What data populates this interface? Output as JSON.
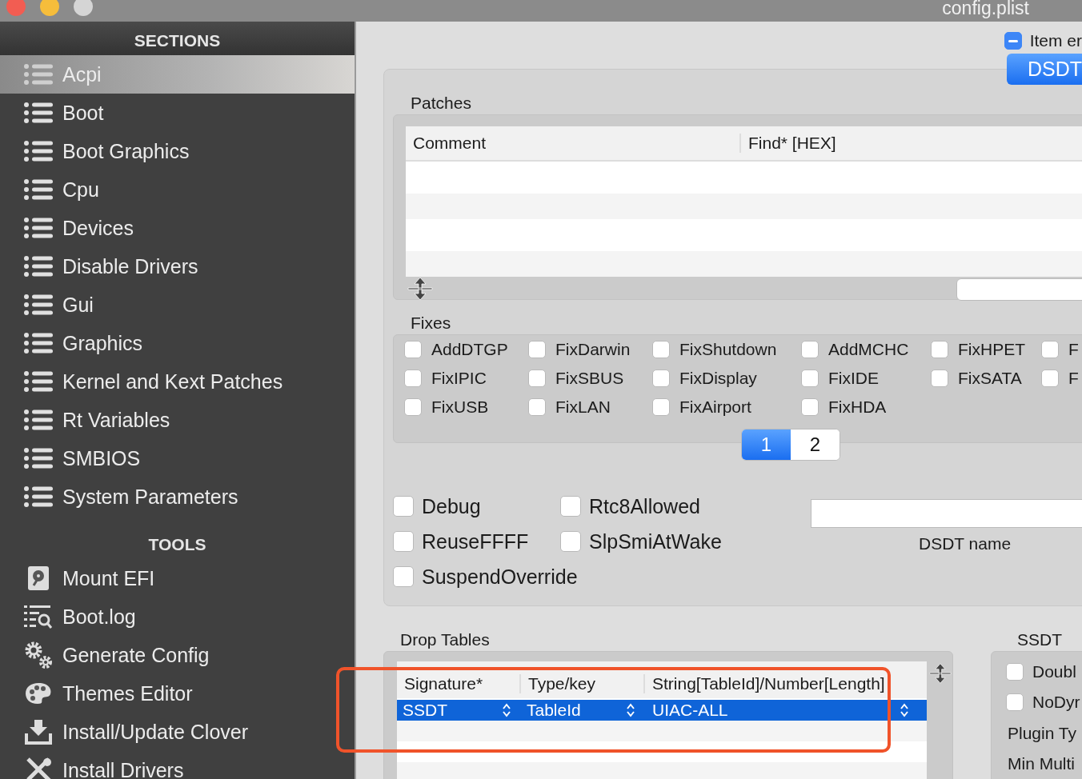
{
  "window": {
    "title": "config.plist"
  },
  "sidebar": {
    "sections_heading": "SECTIONS",
    "sections": [
      {
        "label": "Acpi",
        "selected": true
      },
      {
        "label": "Boot",
        "selected": false
      },
      {
        "label": "Boot Graphics",
        "selected": false
      },
      {
        "label": "Cpu",
        "selected": false
      },
      {
        "label": "Devices",
        "selected": false
      },
      {
        "label": "Disable Drivers",
        "selected": false
      },
      {
        "label": "Gui",
        "selected": false
      },
      {
        "label": "Graphics",
        "selected": false
      },
      {
        "label": "Kernel and Kext Patches",
        "selected": false
      },
      {
        "label": "Rt Variables",
        "selected": false
      },
      {
        "label": "SMBIOS",
        "selected": false
      },
      {
        "label": "System Parameters",
        "selected": false
      }
    ],
    "tools_heading": "TOOLS",
    "tools": [
      {
        "label": "Mount EFI",
        "kind": "disk"
      },
      {
        "label": "Boot.log",
        "kind": "log"
      },
      {
        "label": "Generate Config",
        "kind": "gears"
      },
      {
        "label": "Themes Editor",
        "kind": "palette"
      },
      {
        "label": "Install/Update Clover",
        "kind": "download"
      },
      {
        "label": "Install Drivers",
        "kind": "tools"
      }
    ]
  },
  "header": {
    "item_toggle": {
      "label": "Item er",
      "checked": true
    },
    "dsdt_button": "DSDT"
  },
  "patches": {
    "title": "Patches",
    "columns": [
      "Comment",
      "Find* [HEX]"
    ]
  },
  "fixes": {
    "title": "Fixes",
    "items": [
      {
        "label": "AddDTGP",
        "checked": false
      },
      {
        "label": "FixDarwin",
        "checked": false
      },
      {
        "label": "FixShutdown",
        "checked": false
      },
      {
        "label": "AddMCHC",
        "checked": false
      },
      {
        "label": "FixHPET",
        "checked": false
      },
      {
        "label": "F",
        "checked": false
      },
      {
        "label": "FixIPIC",
        "checked": false
      },
      {
        "label": "FixSBUS",
        "checked": false
      },
      {
        "label": "FixDisplay",
        "checked": false
      },
      {
        "label": "FixIDE",
        "checked": false
      },
      {
        "label": "FixSATA",
        "checked": false
      },
      {
        "label": "F",
        "checked": false
      },
      {
        "label": "FixUSB",
        "checked": false
      },
      {
        "label": "FixLAN",
        "checked": false
      },
      {
        "label": "FixAirport",
        "checked": false
      },
      {
        "label": "FixHDA",
        "checked": false
      }
    ],
    "pages": [
      {
        "label": "1",
        "selected": true
      },
      {
        "label": "2",
        "selected": false
      }
    ]
  },
  "options": [
    {
      "label": "Debug",
      "checked": false
    },
    {
      "label": "Rtc8Allowed",
      "checked": false
    },
    {
      "label": "ReuseFFFF",
      "checked": false
    },
    {
      "label": "SlpSmiAtWake",
      "checked": false
    },
    {
      "label": "SuspendOverride",
      "checked": false
    }
  ],
  "dsdt_name": {
    "label": "DSDT name"
  },
  "drop_tables": {
    "title": "Drop Tables",
    "columns": [
      "Signature*",
      "Type/key",
      "String[TableId]/Number[Length]"
    ],
    "rows": [
      {
        "signature": "SSDT",
        "type": "TableId",
        "string": "UIAC-ALL",
        "selected": true
      }
    ]
  },
  "ssdt": {
    "title": "SSDT",
    "checkboxes": [
      {
        "label": "Doubl",
        "checked": false
      },
      {
        "label": "NoDyr",
        "checked": false
      }
    ],
    "labels": [
      "Plugin Ty",
      "Min Multi"
    ]
  }
}
